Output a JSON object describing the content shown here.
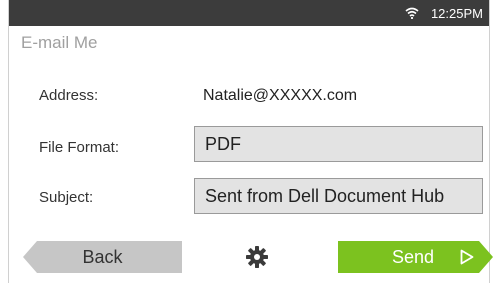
{
  "status_bar": {
    "time": "12:25PM",
    "wifi_icon": "wifi-icon"
  },
  "header": {
    "title": "E-mail Me"
  },
  "form": {
    "address": {
      "label": "Address:",
      "value": "Natalie@XXXXX.com"
    },
    "file_format": {
      "label": "File Format:",
      "value": "PDF"
    },
    "subject": {
      "label": "Subject:",
      "value": "Sent from Dell Document Hub"
    }
  },
  "footer": {
    "back_label": "Back",
    "settings_icon": "gear-icon",
    "send_label": "Send",
    "send_icon": "play-icon"
  },
  "colors": {
    "status_bar": "#3c3c3c",
    "send_button": "#7cc21f",
    "back_button": "#c6c6c6",
    "field_background": "#e3e3e3"
  }
}
